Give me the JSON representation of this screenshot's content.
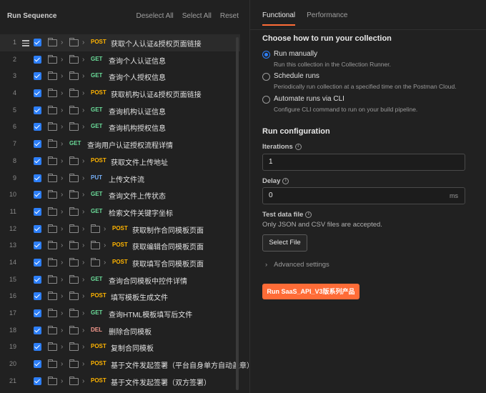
{
  "sequence": {
    "title": "Run Sequence",
    "deselect_all": "Deselect All",
    "select_all": "Select All",
    "reset": "Reset",
    "rows": [
      {
        "num": "1",
        "depth": 2,
        "method": "POST",
        "name": "获取个人认证&授权页面链接"
      },
      {
        "num": "2",
        "depth": 2,
        "method": "GET",
        "name": "查询个人认证信息"
      },
      {
        "num": "3",
        "depth": 2,
        "method": "GET",
        "name": "查询个人授权信息"
      },
      {
        "num": "4",
        "depth": 2,
        "method": "POST",
        "name": "获取机构认证&授权页面链接"
      },
      {
        "num": "5",
        "depth": 2,
        "method": "GET",
        "name": "查询机构认证信息"
      },
      {
        "num": "6",
        "depth": 2,
        "method": "GET",
        "name": "查询机构授权信息"
      },
      {
        "num": "7",
        "depth": 1,
        "method": "GET",
        "name": "查询用户认证授权流程详情"
      },
      {
        "num": "8",
        "depth": 2,
        "method": "POST",
        "name": "获取文件上传地址"
      },
      {
        "num": "9",
        "depth": 2,
        "method": "PUT",
        "name": "上传文件流"
      },
      {
        "num": "10",
        "depth": 2,
        "method": "GET",
        "name": "查询文件上传状态"
      },
      {
        "num": "11",
        "depth": 2,
        "method": "GET",
        "name": "检索文件关键字坐标"
      },
      {
        "num": "12",
        "depth": 3,
        "method": "POST",
        "name": "获取制作合同模板页面"
      },
      {
        "num": "13",
        "depth": 3,
        "method": "POST",
        "name": "获取编辑合同模板页面"
      },
      {
        "num": "14",
        "depth": 3,
        "method": "POST",
        "name": "获取填写合同模板页面"
      },
      {
        "num": "15",
        "depth": 2,
        "method": "GET",
        "name": "查询合同模板中控件详情"
      },
      {
        "num": "16",
        "depth": 2,
        "method": "POST",
        "name": "填写模板生成文件"
      },
      {
        "num": "17",
        "depth": 2,
        "method": "GET",
        "name": "查询HTML模板填写后文件"
      },
      {
        "num": "18",
        "depth": 2,
        "method": "DEL",
        "name": "删除合同模板"
      },
      {
        "num": "19",
        "depth": 2,
        "method": "POST",
        "name": "复制合同模板"
      },
      {
        "num": "20",
        "depth": 2,
        "method": "POST",
        "name": "基于文件发起签署（平台自身单方自动盖章）"
      },
      {
        "num": "21",
        "depth": 2,
        "method": "POST",
        "name": "基于文件发起签署（双方签署）"
      }
    ]
  },
  "tabs": [
    {
      "label": "Functional"
    },
    {
      "label": "Performance"
    }
  ],
  "run_how": {
    "title": "Choose how to run your collection",
    "options": [
      {
        "label": "Run manually",
        "desc": "Run this collection in the Collection Runner."
      },
      {
        "label": "Schedule runs",
        "desc": "Periodically run collection at a specified time on the Postman Cloud."
      },
      {
        "label": "Automate runs via CLI",
        "desc": "Configure CLI command to run on your build pipeline."
      }
    ]
  },
  "config": {
    "title": "Run configuration",
    "iterations_label": "Iterations",
    "iterations_value": "1",
    "delay_label": "Delay",
    "delay_value": "0",
    "delay_unit": "ms",
    "test_data_label": "Test data file",
    "test_data_note": "Only JSON and CSV files are accepted.",
    "select_file": "Select File",
    "advanced": "Advanced settings",
    "run_button": "Run SaaS_API_V3版系列产品"
  },
  "colors": {
    "accent": "#ff6c37",
    "checkbox": "#2d7ff9",
    "post": "#ffb400",
    "get": "#6bdd9a",
    "put": "#74aef6",
    "del": "#f79a8e"
  }
}
